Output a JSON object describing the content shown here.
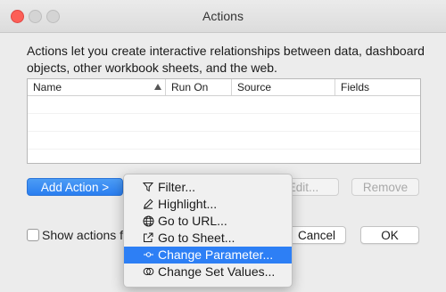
{
  "window": {
    "title": "Actions"
  },
  "description": "Actions let you create interactive relationships between data, dashboard objects, other workbook sheets, and the web.",
  "table": {
    "columns": [
      "Name",
      "Run On",
      "Source",
      "Fields"
    ],
    "rows": []
  },
  "buttons": {
    "add_action": "Add Action >",
    "edit": "Edit...",
    "remove": "Remove",
    "cancel": "Cancel",
    "ok": "OK"
  },
  "checkbox": {
    "label": "Show actions fo",
    "checked": false
  },
  "menu": {
    "items": [
      {
        "label": "Filter...",
        "icon": "filter-icon"
      },
      {
        "label": "Highlight...",
        "icon": "highlight-pen-icon"
      },
      {
        "label": "Go to URL...",
        "icon": "globe-icon"
      },
      {
        "label": "Go to Sheet...",
        "icon": "external-sheet-icon"
      },
      {
        "label": "Change Parameter...",
        "icon": "parameter-icon",
        "selected": true
      },
      {
        "label": "Change Set Values...",
        "icon": "set-icon"
      }
    ]
  },
  "colors": {
    "accent": "#2d7ff5",
    "close": "#fc5f57"
  }
}
